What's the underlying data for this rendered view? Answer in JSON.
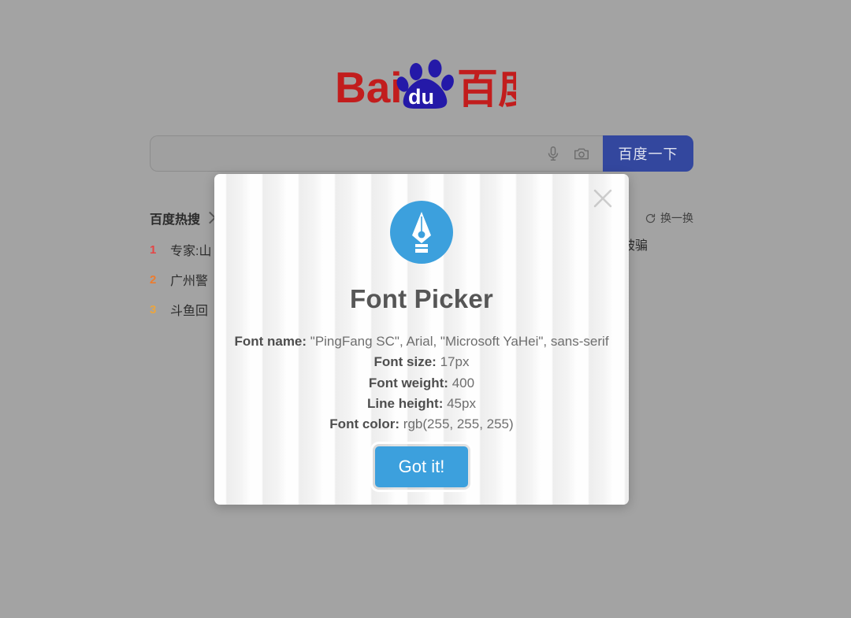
{
  "page": {
    "background_color": "#a3a3a3",
    "logo_alt": "Bai du 百度",
    "logo_red": "#c21d1d",
    "logo_blue": "#2419a8"
  },
  "search": {
    "value": "",
    "placeholder": "",
    "mic_icon": "microphone-icon",
    "camera_icon": "camera-icon",
    "button_label": "百度一下",
    "button_color": "#33479e"
  },
  "hot_search": {
    "title": "百度热搜",
    "chevron_icon": "chevron-right-icon",
    "refresh_icon": "refresh-icon",
    "refresh_label": "换一换",
    "items": [
      {
        "rank": "1",
        "rank_color": "#e54545",
        "text": "专家:山",
        "tail": "被骗"
      },
      {
        "rank": "2",
        "rank_color": "#ed7c2e",
        "text": "广州警",
        "tail": ""
      },
      {
        "rank": "3",
        "rank_color": "#eaa540",
        "text": "斗鱼回",
        "tail": ""
      }
    ]
  },
  "modal": {
    "close_icon": "close-icon",
    "logo_icon": "pen-nib-icon",
    "accent_color": "#3ca0dd",
    "title": "Font Picker",
    "properties": [
      {
        "key": "Font name:",
        "value": "\"PingFang SC\", Arial, \"Microsoft YaHei\", sans-serif"
      },
      {
        "key": "Font size:",
        "value": "17px"
      },
      {
        "key": "Font weight:",
        "value": "400"
      },
      {
        "key": "Line height:",
        "value": "45px"
      },
      {
        "key": "Font color:",
        "value": "rgb(255, 255, 255)"
      }
    ],
    "button_label": "Got it!"
  }
}
